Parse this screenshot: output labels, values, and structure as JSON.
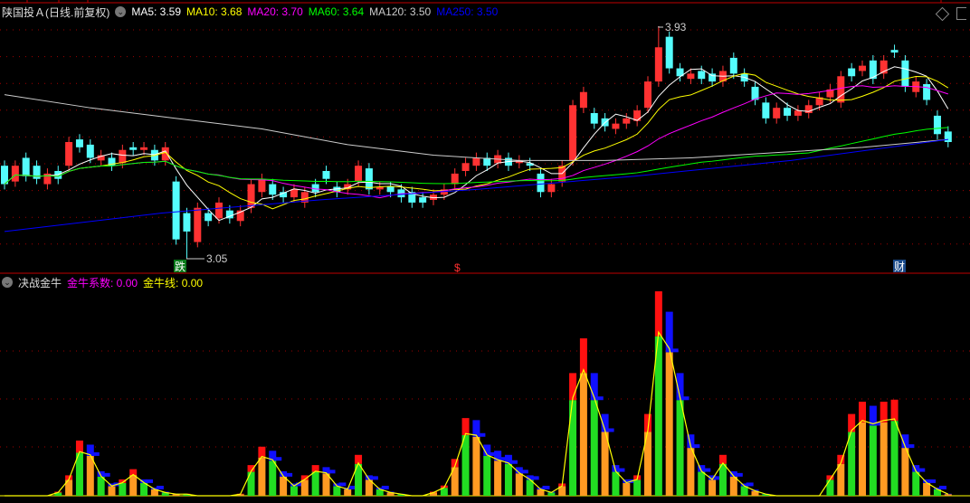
{
  "header": {
    "title": "陕国投Ａ(日线.前复权)",
    "ma": [
      {
        "label": "MA5: 3.59",
        "color": "#ffffff"
      },
      {
        "label": "MA10: 3.68",
        "color": "#ffff00"
      },
      {
        "label": "MA20: 3.70",
        "color": "#ff00ff"
      },
      {
        "label": "MA60: 3.64",
        "color": "#00ff00"
      },
      {
        "label": "MA120: 3.50",
        "color": "#cccccc"
      },
      {
        "label": "MA250: 3.50",
        "color": "#0000ff"
      }
    ]
  },
  "indicator": {
    "name": "决战金牛",
    "coef": "金牛系数: 0.00",
    "line": "金牛线: 0.00"
  },
  "annotations": {
    "high": "3.93",
    "low": "3.05",
    "mark_drop": "跌",
    "mark_dollar": "$",
    "mark_fin": "财"
  },
  "colors": {
    "up": "#ff3232",
    "down": "#54fcfc",
    "grid": "#a00000",
    "ma120": "#cccccc",
    "ma250": "#0000ff"
  },
  "price_range": [
    3.05,
    3.93
  ],
  "candles": [
    [
      3.4,
      3.33
    ],
    [
      3.34,
      3.4
    ],
    [
      3.43,
      3.36
    ],
    [
      3.4,
      3.35
    ],
    [
      3.33,
      3.37
    ],
    [
      3.38,
      3.35
    ],
    [
      3.4,
      3.49
    ],
    [
      3.5,
      3.47
    ],
    [
      3.48,
      3.43
    ],
    [
      3.42,
      3.44
    ],
    [
      3.43,
      3.4
    ],
    [
      3.41,
      3.46
    ],
    [
      3.47,
      3.46
    ],
    [
      3.46,
      3.47
    ],
    [
      3.46,
      3.42
    ],
    [
      3.42,
      3.47
    ],
    [
      3.34,
      3.12
    ],
    [
      3.22,
      3.15
    ],
    [
      3.11,
      3.24
    ],
    [
      3.22,
      3.19
    ],
    [
      3.2,
      3.26
    ],
    [
      3.23,
      3.2
    ],
    [
      3.19,
      3.23
    ],
    [
      3.24,
      3.33
    ],
    [
      3.3,
      3.35
    ],
    [
      3.33,
      3.29
    ],
    [
      3.3,
      3.28
    ],
    [
      3.28,
      3.31
    ],
    [
      3.26,
      3.3
    ],
    [
      3.33,
      3.3
    ],
    [
      3.38,
      3.35
    ],
    [
      3.32,
      3.3
    ],
    [
      3.31,
      3.33
    ],
    [
      3.34,
      3.4
    ],
    [
      3.39,
      3.31
    ],
    [
      3.31,
      3.32
    ],
    [
      3.32,
      3.3
    ],
    [
      3.31,
      3.28
    ],
    [
      3.3,
      3.26
    ],
    [
      3.28,
      3.26
    ],
    [
      3.27,
      3.29
    ],
    [
      3.29,
      3.31
    ],
    [
      3.33,
      3.37
    ],
    [
      3.38,
      3.41
    ],
    [
      3.4,
      3.43
    ],
    [
      3.43,
      3.4
    ],
    [
      3.41,
      3.44
    ],
    [
      3.43,
      3.4
    ],
    [
      3.41,
      3.42
    ],
    [
      3.41,
      3.4
    ],
    [
      3.37,
      3.3
    ],
    [
      3.3,
      3.33
    ],
    [
      3.34,
      3.4
    ],
    [
      3.42,
      3.63
    ],
    [
      3.62,
      3.68
    ],
    [
      3.6,
      3.56
    ],
    [
      3.58,
      3.55
    ],
    [
      3.54,
      3.56
    ],
    [
      3.56,
      3.58
    ],
    [
      3.57,
      3.61
    ],
    [
      3.62,
      3.72
    ],
    [
      3.72,
      3.85
    ],
    [
      3.89,
      3.77
    ],
    [
      3.77,
      3.74
    ],
    [
      3.73,
      3.75
    ],
    [
      3.76,
      3.73
    ],
    [
      3.75,
      3.72
    ],
    [
      3.72,
      3.76
    ],
    [
      3.81,
      3.75
    ],
    [
      3.75,
      3.72
    ],
    [
      3.7,
      3.65
    ],
    [
      3.64,
      3.58
    ],
    [
      3.58,
      3.62
    ],
    [
      3.62,
      3.59
    ],
    [
      3.59,
      3.61
    ],
    [
      3.6,
      3.63
    ],
    [
      3.63,
      3.66
    ],
    [
      3.66,
      3.69
    ],
    [
      3.64,
      3.74
    ],
    [
      3.77,
      3.74
    ],
    [
      3.76,
      3.78
    ],
    [
      3.8,
      3.73
    ],
    [
      3.75,
      3.8
    ],
    [
      3.84,
      3.83
    ],
    [
      3.8,
      3.7
    ],
    [
      3.68,
      3.72
    ],
    [
      3.71,
      3.65
    ],
    [
      3.59,
      3.52
    ],
    [
      3.53,
      3.49
    ]
  ],
  "ma120": [
    3.67,
    3.62,
    3.58,
    3.54,
    3.48,
    3.44,
    3.42,
    3.42,
    3.43,
    3.45,
    3.47,
    3.5
  ],
  "ma250": [
    3.15,
    3.22,
    3.27,
    3.31,
    3.36,
    3.42,
    3.5
  ],
  "indicator_values": [
    0,
    0,
    0,
    0,
    0,
    2,
    10,
    27,
    25,
    12,
    6,
    8,
    13,
    8,
    4,
    2,
    1,
    1,
    0,
    0,
    0,
    0,
    1,
    15,
    24,
    22,
    12,
    6,
    10,
    15,
    14,
    6,
    4,
    20,
    10,
    4,
    2,
    1,
    0,
    0,
    2,
    5,
    18,
    38,
    37,
    25,
    22,
    20,
    14,
    10,
    4,
    2,
    6,
    60,
    77,
    60,
    40,
    15,
    8,
    10,
    40,
    100,
    90,
    60,
    30,
    15,
    10,
    20,
    12,
    6,
    3,
    1,
    0,
    0,
    0,
    0,
    0,
    10,
    20,
    40,
    46,
    44,
    46,
    47,
    30,
    15,
    8,
    4,
    1
  ]
}
